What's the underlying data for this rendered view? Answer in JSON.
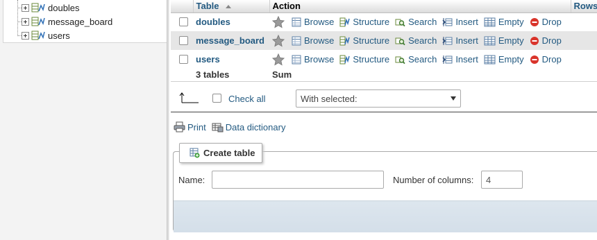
{
  "nav": {
    "items": [
      {
        "label": "doubles"
      },
      {
        "label": "message_board"
      },
      {
        "label": "users"
      }
    ]
  },
  "table_list": {
    "headers": {
      "table": "Table",
      "action": "Action",
      "rows": "Rows"
    },
    "rows": [
      {
        "name": "doubles"
      },
      {
        "name": "message_board"
      },
      {
        "name": "users"
      }
    ],
    "actions": {
      "browse": "Browse",
      "structure": "Structure",
      "search": "Search",
      "insert": "Insert",
      "empty": "Empty",
      "drop": "Drop"
    },
    "summary": {
      "count": "3 tables",
      "sum": "Sum"
    }
  },
  "with_selected": {
    "check_all": "Check all",
    "select_value": "With selected:"
  },
  "links": {
    "print": "Print",
    "data_dictionary": "Data dictionary"
  },
  "create_table": {
    "legend": "Create table",
    "name_label": "Name:",
    "name_value": "",
    "columns_label": "Number of columns:",
    "columns_value": "4"
  },
  "colors": {
    "link": "#235a81",
    "row_alt": "#e6e6e6",
    "drop": "#d9342b"
  }
}
